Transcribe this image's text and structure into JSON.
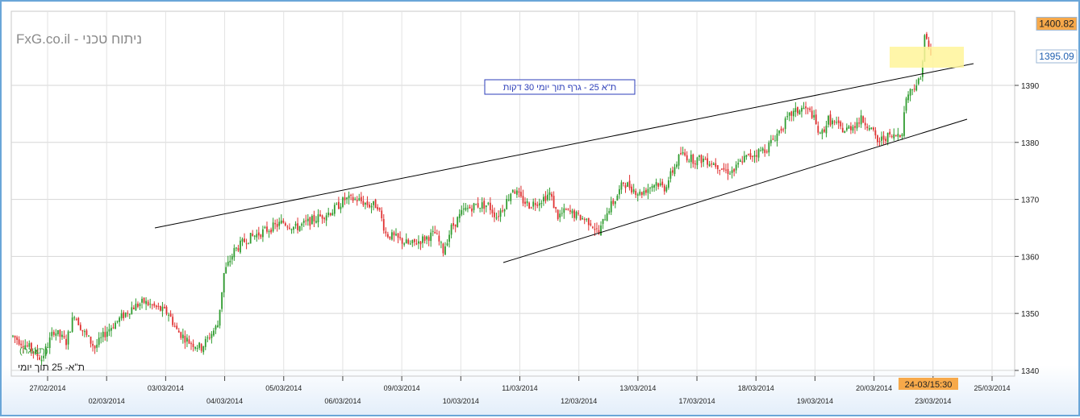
{
  "chart_data": {
    "type": "candlestick",
    "watermark": "FxG.co.il - ניתוח טכני",
    "title": "ת\"א 25 - גרף תוך יומי 30 דקות",
    "series_label": "ת\"א- 25 תוך יומי",
    "series_sublabel": "(תצוגה)",
    "ylim": [
      1339,
      1403
    ],
    "y_ticks": [
      1340,
      1350,
      1360,
      1370,
      1380,
      1390
    ],
    "price_labels": [
      {
        "value": 1400.82,
        "text": "1400.82",
        "fill": "#f7a94a",
        "color": "#222222"
      },
      {
        "value": 1395.09,
        "text": "1395.09",
        "fill": "#ffffff",
        "color": "#1f5fb0"
      }
    ],
    "cursor_time": "24-03/15:30",
    "date_labels": [
      "27/02/2014",
      "02/03/2014",
      "03/03/2014",
      "04/03/2014",
      "05/03/2014",
      "06/03/2014",
      "09/03/2014",
      "10/03/2014",
      "11/03/2014",
      "12/03/2014",
      "13/03/2014",
      "17/03/2014",
      "18/03/2014",
      "19/03/2014",
      "20/03/2014",
      "23/03/2014",
      "25/03/2014"
    ],
    "grid": true,
    "up_color": "#2e9b2e",
    "down_color": "#e03131",
    "line_color": "#000000",
    "highlight_color": "#fff59a",
    "label_box_color": "#2b3db8",
    "path_points": [
      [
        0,
        1346
      ],
      [
        8,
        1344
      ],
      [
        14,
        1342
      ],
      [
        20,
        1347
      ],
      [
        26,
        1345
      ],
      [
        30,
        1350
      ],
      [
        34,
        1347
      ],
      [
        40,
        1344
      ],
      [
        46,
        1347
      ],
      [
        52,
        1349
      ],
      [
        58,
        1351
      ],
      [
        64,
        1352
      ],
      [
        70,
        1351
      ],
      [
        76,
        1350
      ],
      [
        80,
        1347
      ],
      [
        86,
        1345
      ],
      [
        92,
        1344
      ],
      [
        96,
        1346
      ],
      [
        100,
        1348
      ],
      [
        103,
        1357
      ],
      [
        108,
        1361
      ],
      [
        114,
        1363
      ],
      [
        120,
        1364
      ],
      [
        126,
        1365
      ],
      [
        132,
        1366
      ],
      [
        138,
        1365
      ],
      [
        144,
        1366
      ],
      [
        150,
        1367
      ],
      [
        156,
        1368
      ],
      [
        162,
        1370
      ],
      [
        168,
        1370
      ],
      [
        174,
        1369
      ],
      [
        178,
        1369
      ],
      [
        182,
        1364
      ],
      [
        188,
        1363
      ],
      [
        194,
        1362
      ],
      [
        200,
        1363
      ],
      [
        206,
        1364
      ],
      [
        210,
        1361
      ],
      [
        214,
        1365
      ],
      [
        220,
        1368
      ],
      [
        226,
        1369
      ],
      [
        232,
        1369
      ],
      [
        236,
        1367
      ],
      [
        240,
        1369
      ],
      [
        244,
        1372
      ],
      [
        248,
        1370
      ],
      [
        252,
        1369
      ],
      [
        258,
        1370
      ],
      [
        262,
        1371
      ],
      [
        266,
        1367
      ],
      [
        270,
        1368
      ],
      [
        276,
        1367
      ],
      [
        282,
        1366
      ],
      [
        286,
        1364
      ],
      [
        290,
        1368
      ],
      [
        294,
        1370
      ],
      [
        298,
        1373
      ],
      [
        302,
        1372
      ],
      [
        306,
        1371
      ],
      [
        310,
        1372
      ],
      [
        314,
        1373
      ],
      [
        318,
        1372
      ],
      [
        322,
        1375
      ],
      [
        326,
        1378
      ],
      [
        332,
        1377
      ],
      [
        338,
        1377
      ],
      [
        344,
        1376
      ],
      [
        348,
        1375
      ],
      [
        352,
        1375
      ],
      [
        356,
        1377
      ],
      [
        362,
        1378
      ],
      [
        368,
        1379
      ],
      [
        374,
        1382
      ],
      [
        380,
        1385
      ],
      [
        386,
        1386
      ],
      [
        390,
        1385
      ],
      [
        394,
        1381
      ],
      [
        398,
        1384
      ],
      [
        402,
        1383
      ],
      [
        406,
        1382
      ],
      [
        410,
        1383
      ],
      [
        414,
        1384
      ],
      [
        418,
        1383
      ],
      [
        422,
        1380
      ],
      [
        426,
        1381
      ],
      [
        430,
        1381
      ],
      [
        434,
        1382
      ],
      [
        436,
        1388
      ],
      [
        440,
        1390
      ],
      [
        443,
        1391
      ],
      [
        445,
        1399
      ],
      [
        448,
        1395
      ]
    ]
  }
}
